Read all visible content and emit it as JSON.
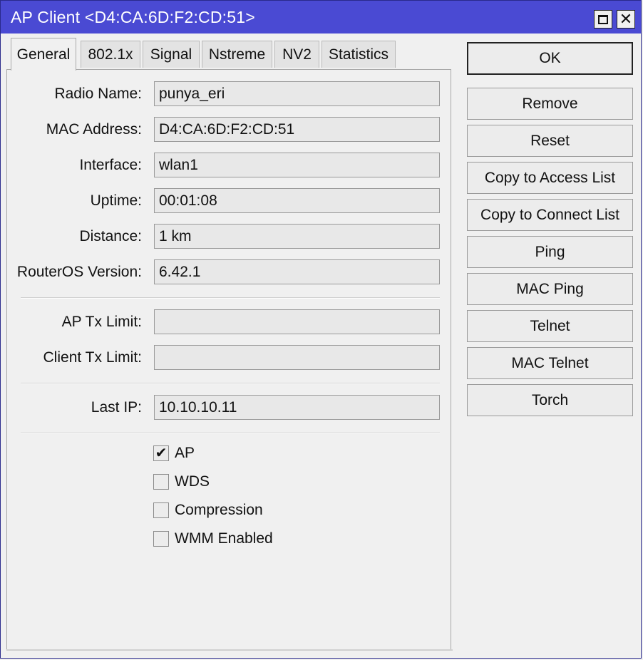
{
  "window": {
    "title": "AP Client <D4:CA:6D:F2:CD:51>",
    "maximize_icon": "maximize-icon",
    "close_icon": "close-icon",
    "close_glyph": "✕"
  },
  "tabs": [
    {
      "label": "General",
      "active": true
    },
    {
      "label": "802.1x",
      "active": false
    },
    {
      "label": "Signal",
      "active": false
    },
    {
      "label": "Nstreme",
      "active": false
    },
    {
      "label": "NV2",
      "active": false
    },
    {
      "label": "Statistics",
      "active": false
    }
  ],
  "fields": {
    "radio_name": {
      "label": "Radio Name:",
      "value": "punya_eri"
    },
    "mac_address": {
      "label": "MAC Address:",
      "value": "D4:CA:6D:F2:CD:51"
    },
    "interface": {
      "label": "Interface:",
      "value": "wlan1"
    },
    "uptime": {
      "label": "Uptime:",
      "value": "00:01:08"
    },
    "distance": {
      "label": "Distance:",
      "value": "1 km"
    },
    "routeros_version": {
      "label": "RouterOS Version:",
      "value": "6.42.1"
    },
    "ap_tx_limit": {
      "label": "AP Tx Limit:",
      "value": ""
    },
    "client_tx_limit": {
      "label": "Client Tx Limit:",
      "value": ""
    },
    "last_ip": {
      "label": "Last IP:",
      "value": "10.10.10.11"
    }
  },
  "checkboxes": [
    {
      "label": "AP",
      "checked": true,
      "mark": "✔"
    },
    {
      "label": "WDS",
      "checked": false,
      "mark": ""
    },
    {
      "label": "Compression",
      "checked": false,
      "mark": ""
    },
    {
      "label": "WMM Enabled",
      "checked": false,
      "mark": ""
    }
  ],
  "buttons": {
    "ok": "OK",
    "remove": "Remove",
    "reset": "Reset",
    "copy_access": "Copy to Access List",
    "copy_connect": "Copy to Connect List",
    "ping": "Ping",
    "mac_ping": "MAC Ping",
    "telnet": "Telnet",
    "mac_telnet": "MAC Telnet",
    "torch": "Torch"
  }
}
